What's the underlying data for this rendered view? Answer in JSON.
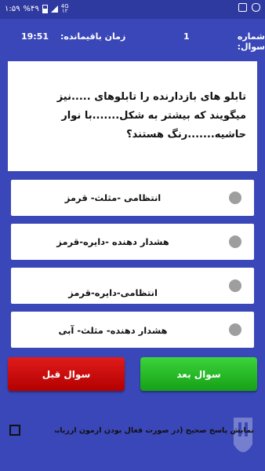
{
  "status_bar": {
    "time": "۱:۵۹",
    "battery": "%۴۹",
    "network": "4G",
    "network_sub": "۱۲",
    "icons": [
      "shield-icon",
      "checkbox-icon",
      "signal-icon",
      "battery-icon"
    ]
  },
  "info": {
    "question_number_label": "شماره سوال:",
    "question_number": "1",
    "time_remaining_label": "زمان باقیمانده:",
    "time_remaining": "19:51"
  },
  "question": {
    "text": "تابلو های بازدارنده را تابلوهای .....نیز میگویند که بیشتر به شکل.......با نوار حاشیه.......رنگ هستند؟"
  },
  "options": [
    {
      "label": "انتظامی -مثلث- قرمز",
      "selected": false
    },
    {
      "label": "هشدار دهنده -دایره-قرمز",
      "selected": false
    },
    {
      "label": "انتظامی-دایره-قرمز",
      "selected": false
    },
    {
      "label": "هشدار دهنده- مثلث- آبی",
      "selected": false
    }
  ],
  "buttons": {
    "prev_label": "سوال قبل",
    "next_label": "سوال بعد"
  },
  "footer": {
    "show_answer_label": "نمایش پاسخ صحیح (در صورت فعال بودن آزمون ارزیابی نمی شود)",
    "checked": false
  },
  "colors": {
    "background": "#3a47b8",
    "status_bar": "#2f3aa0",
    "prev_button": "#cc0f0f",
    "next_button": "#22b822",
    "radio": "#9e9e9e"
  }
}
